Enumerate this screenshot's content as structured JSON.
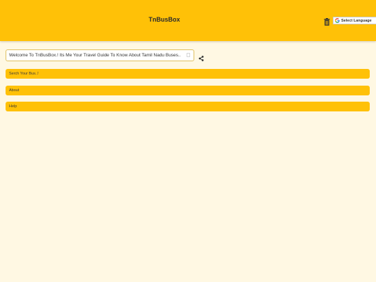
{
  "header": {
    "title": "TnBusBox",
    "language_label": "Select Language"
  },
  "welcome": {
    "value": "Welcome To TnBusBox.! Its Me Your Travel Guide To Know About Tamil Nadu Buses.."
  },
  "accordion": [
    {
      "label": "Serch Your Bus..!"
    },
    {
      "label": "About"
    },
    {
      "label": "Help"
    }
  ],
  "colors": {
    "accent": "#ffc107",
    "background": "#fff8e3",
    "text": "#2b2b2b"
  },
  "icons": {
    "delete": "trash-icon",
    "share": "share-icon",
    "google": "google-g-icon"
  }
}
